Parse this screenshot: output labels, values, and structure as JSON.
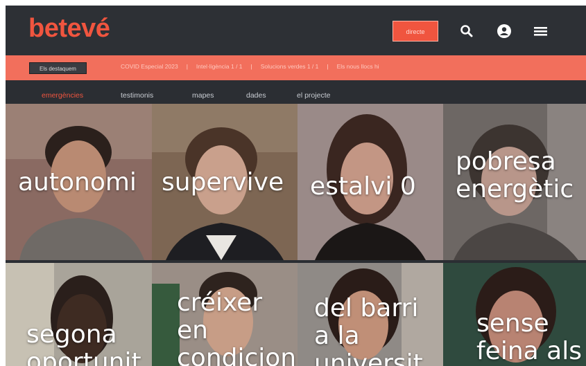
{
  "header": {
    "logo": "betevé",
    "cta_label": "directe",
    "icons": [
      "search-icon",
      "user-icon",
      "menu-icon"
    ]
  },
  "strip": {
    "tag": "Els destaquem",
    "items": [
      "COVID Especial 2023",
      "Intel·ligència 1 / 1",
      "Solucions verdes 1 / 1",
      "Els nous llocs hi"
    ]
  },
  "subnav": {
    "items": [
      "emergències",
      "testimonis",
      "mapes",
      "dades",
      "el projecte"
    ]
  },
  "tiles": [
    {
      "label": "autonomi"
    },
    {
      "label": "supervive"
    },
    {
      "label": "estalvi 0"
    },
    {
      "label": "pobresa\nenergètic"
    },
    {
      "label": "segona\noportunit"
    },
    {
      "label": "créixer\nen\ncondicion"
    },
    {
      "label": "del barri\na la\nuniversit"
    },
    {
      "label": "sense\nfeina als"
    }
  ],
  "colors": {
    "brand": "#f0553f",
    "strip": "#f26f5c",
    "header": "#2d3035"
  }
}
